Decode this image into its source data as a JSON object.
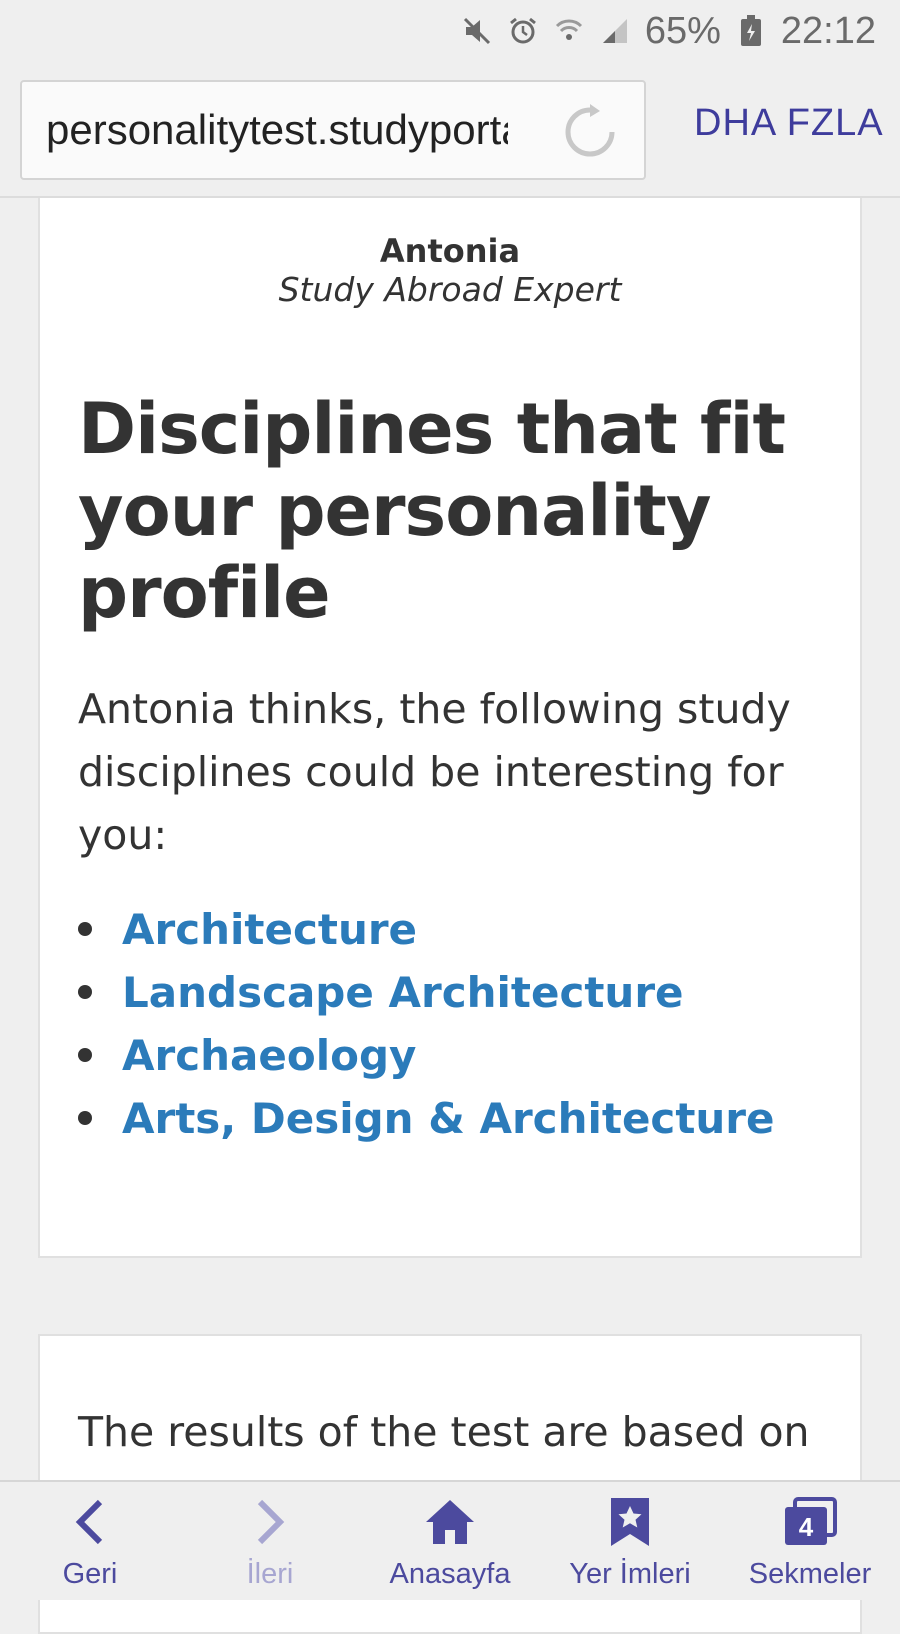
{
  "status_bar": {
    "battery": "65%",
    "time": "22:12",
    "icons": [
      "mute-icon",
      "alarm-icon",
      "wifi-icon",
      "signal-icon",
      "battery-icon"
    ]
  },
  "browser": {
    "url": "personalitytest.studyportals",
    "more_label": "DHA FZLA"
  },
  "card": {
    "expert_name": "Antonia",
    "expert_role": "Study Abroad Expert",
    "headline": "Disciplines that fit your personality profile",
    "intro": "Antonia thinks, the following study disciplines could be interesting for you:",
    "disciplines": [
      "Architecture",
      "Landscape Architecture",
      "Archaeology",
      "Arts, Design & Architecture"
    ]
  },
  "card2": {
    "text": "The results of the test are based on"
  },
  "bottom_nav": [
    {
      "label": "Geri",
      "icon": "back-arrow-icon"
    },
    {
      "label": "İleri",
      "icon": "forward-arrow-icon"
    },
    {
      "label": "Anasayfa",
      "icon": "home-icon"
    },
    {
      "label": "Yer İmleri",
      "icon": "bookmark-star-icon"
    },
    {
      "label": "Sekmeler",
      "icon": "tabs-icon",
      "badge": "4"
    }
  ],
  "colors": {
    "link": "#2b7bba",
    "nav_accent": "#4c4a9e",
    "nav_disabled": "#a7a6d1",
    "text": "#333333"
  }
}
